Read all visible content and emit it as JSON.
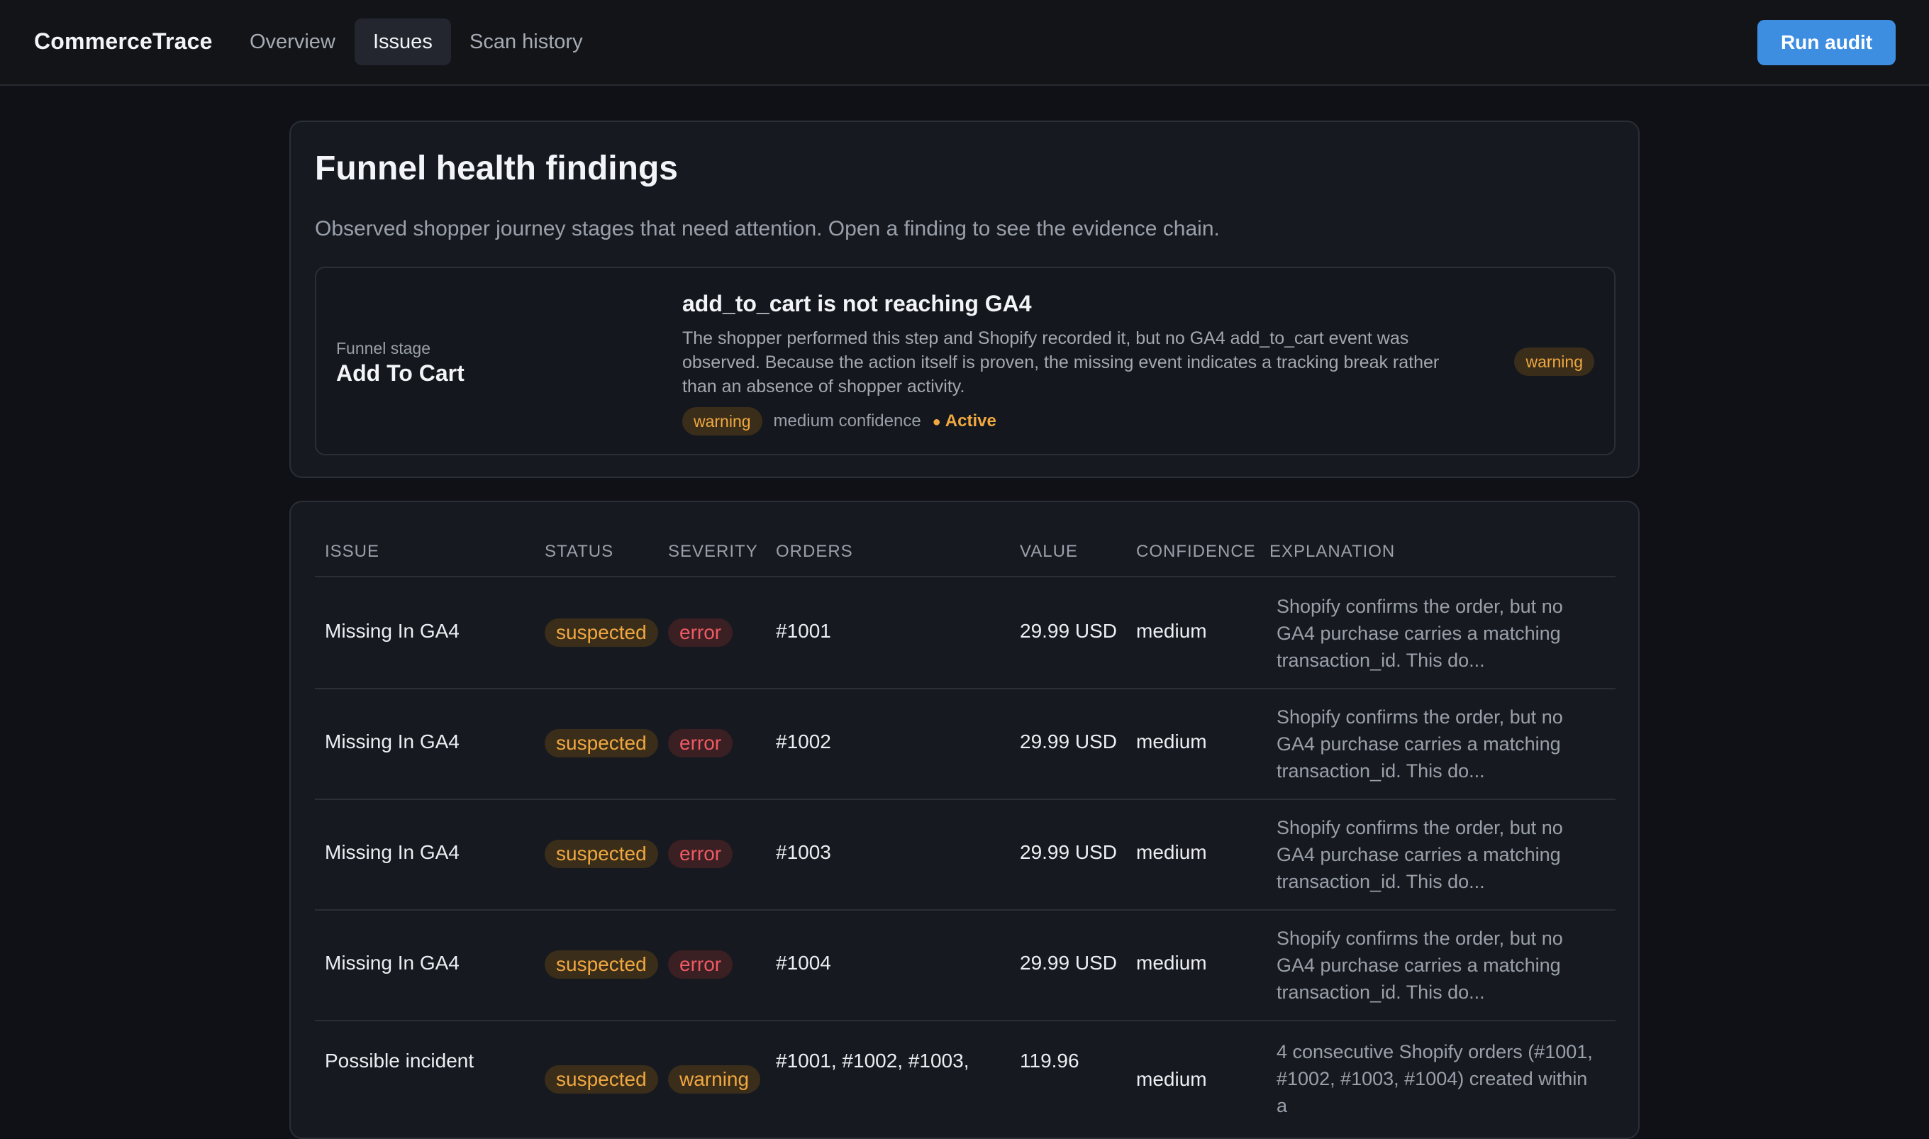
{
  "app": {
    "brand": "CommerceTrace"
  },
  "nav": {
    "tabs": [
      {
        "label": "Overview"
      },
      {
        "label": "Issues"
      },
      {
        "label": "Scan history"
      }
    ],
    "active": "Issues"
  },
  "toolbar": {
    "run_audit_label": "Run audit"
  },
  "page": {
    "title": "Funnel health findings",
    "subtitle": "Observed shopper journey stages that need attention. Open a finding to see the evidence chain."
  },
  "finding": {
    "stage_caption": "Funnel stage",
    "stage_value": "Add To Cart",
    "title": "add_to_cart is not reaching GA4",
    "description": "The shopper performed this step and Shopify recorded it, but no GA4 add_to_cart event was observed. Because the action itself is proven, the missing event indicates a tracking break rather than an absence of shopper activity.",
    "severity": "warning",
    "confidence": "medium confidence",
    "state": "Active",
    "badge": "warning"
  },
  "table": {
    "headers": {
      "issue": "Issue",
      "status": "Status",
      "severity": "Severity",
      "orders": "Orders",
      "value": "Value",
      "confidence": "Confidence",
      "explanation": "Explanation"
    },
    "rows": [
      {
        "issue": "Missing In GA4",
        "status": "suspected",
        "severity": "error",
        "orders": "#1001",
        "value": "29.99 USD",
        "confidence": "medium",
        "explanation": "Shopify confirms the order, but no GA4 purchase carries a matching transaction_id. This do..."
      },
      {
        "issue": "Missing In GA4",
        "status": "suspected",
        "severity": "error",
        "orders": "#1002",
        "value": "29.99 USD",
        "confidence": "medium",
        "explanation": "Shopify confirms the order, but no GA4 purchase carries a matching transaction_id. This do..."
      },
      {
        "issue": "Missing In GA4",
        "status": "suspected",
        "severity": "error",
        "orders": "#1003",
        "value": "29.99 USD",
        "confidence": "medium",
        "explanation": "Shopify confirms the order, but no GA4 purchase carries a matching transaction_id. This do..."
      },
      {
        "issue": "Missing In GA4",
        "status": "suspected",
        "severity": "error",
        "orders": "#1004",
        "value": "29.99 USD",
        "confidence": "medium",
        "explanation": "Shopify confirms the order, but no GA4 purchase carries a matching transaction_id. This do..."
      },
      {
        "issue": "Possible incident",
        "status": "suspected",
        "severity": "warning",
        "orders": "#1001, #1002, #1003,",
        "value": "119.96",
        "confidence": "medium",
        "explanation": "4 consecutive Shopify orders (#1001, #1002, #1003, #1004) created within a"
      }
    ]
  },
  "colors": {
    "accent": "#3d8ee0",
    "warning": "#f0a840",
    "error": "#ef5a63",
    "background": "#0f1116"
  }
}
